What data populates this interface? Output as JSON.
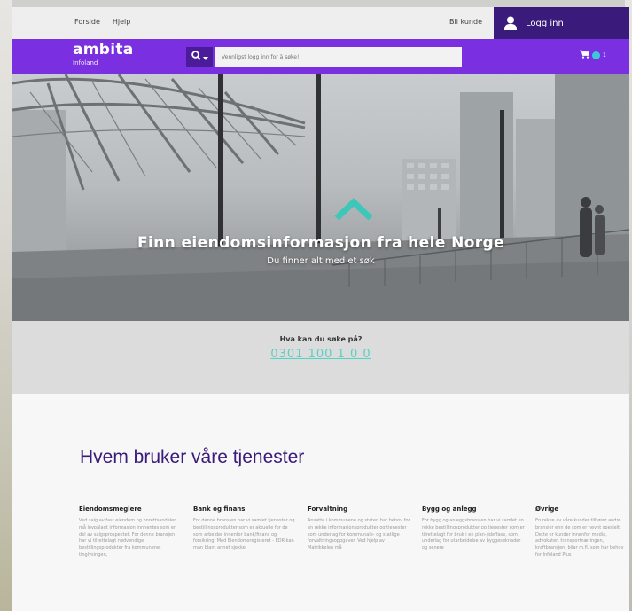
{
  "topbar": {
    "links": [
      "Forside",
      "Hjelp"
    ],
    "become_customer": "Bli kunde",
    "login": "Logg inn"
  },
  "header": {
    "brand": "ambita",
    "sub": "Infoland",
    "search_placeholder": "Vennligst logg inn for å søke!",
    "cart_count": "0",
    "cart_suffix": "1"
  },
  "hero": {
    "title": "Finn eiendomsinformasjon fra hele Norge",
    "subtitle": "Du finner alt med et søk"
  },
  "hint": {
    "question": "Hva kan du søke på?",
    "example": "0301 100 1 0 0"
  },
  "users": {
    "heading": "Hvem bruker våre tjenester",
    "columns": [
      {
        "title": "Eiendomsmeglere",
        "text": "Ved salg av fast eiendom og borettsandeler må lovpålagt informasjon innhentes som en del av salgsprospektet. For denne bransjen har vi tilrettelagt nødvendige bestillingsprodukter fra kommunene, tinglysingen,"
      },
      {
        "title": "Bank og finans",
        "text": "For denne bransjen har vi samlet tjenester og bestillingsprodukter som er aktuelle for de som arbeider innenfor bank/finans og forsikring. Med Eiendomsregisteret - EDR kan man blant annet sjekke"
      },
      {
        "title": "Forvaltning",
        "text": "Ansatte i kommunene og staten har behov for en rekke informasjonsprodukter og tjenester som underlag for kommunale- og statlige forvaltningsoppgaver. Ved hjelp av Matrikkelen må"
      },
      {
        "title": "Bygg og anlegg",
        "text": "For bygg og anleggsbransjen har vi samlet en rekke bestillingsprodukter og tjenester som er tilrettelagt for bruk i en plan-/ideffase, som underlag for utarbeidelse av byggesøknader og senere"
      },
      {
        "title": "Øvrige",
        "text": "En rekke av våre kunder tilhører andre bransjer enn de som er nevnt spesielt. Dette er kunder innenfor media, advokater, transportnæringen, kraftbransjen, bilar m.fl. som har behov for Infoland Plus"
      }
    ]
  },
  "colors": {
    "brand_purple": "#7a2fe0",
    "dark_purple": "#3a1a7a",
    "accent_teal": "#3ec7d8",
    "link_teal": "#56d1c3"
  }
}
